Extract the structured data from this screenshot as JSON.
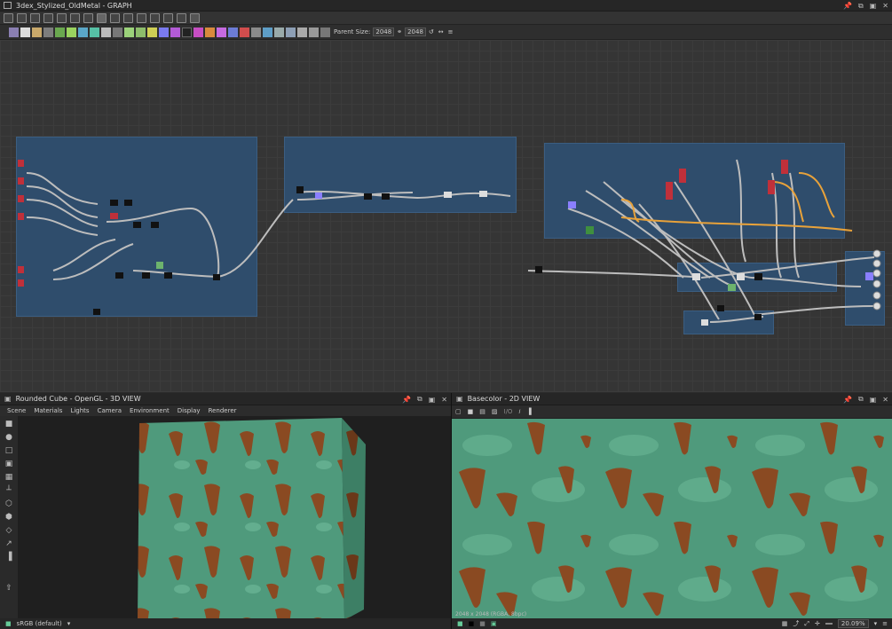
{
  "app": {
    "window_title": "3dex_Stylized_OldMetal - GRAPH"
  },
  "graph_toolbar": {
    "parent_size_label": "Parent Size:",
    "parent_size_value": "2048",
    "output_size_value": "2048"
  },
  "view3d": {
    "title": "Rounded Cube - OpenGL - 3D VIEW",
    "menu": [
      "Scene",
      "Materials",
      "Lights",
      "Camera",
      "Environment",
      "Display",
      "Renderer"
    ],
    "colorspace": "sRGB (default)"
  },
  "view2d": {
    "title": "Basecolor - 2D VIEW",
    "channel": "I/O",
    "info": "2048 x 2048 (RGBA, 8bpc)",
    "zoom": "20.09%"
  },
  "colors": {
    "frame": "#2f4d6c",
    "wire": "#b9b9b9",
    "wire_orange": "#e8a23a",
    "paint_teal": "#4e9a7d",
    "rust": "#8a4a22"
  }
}
